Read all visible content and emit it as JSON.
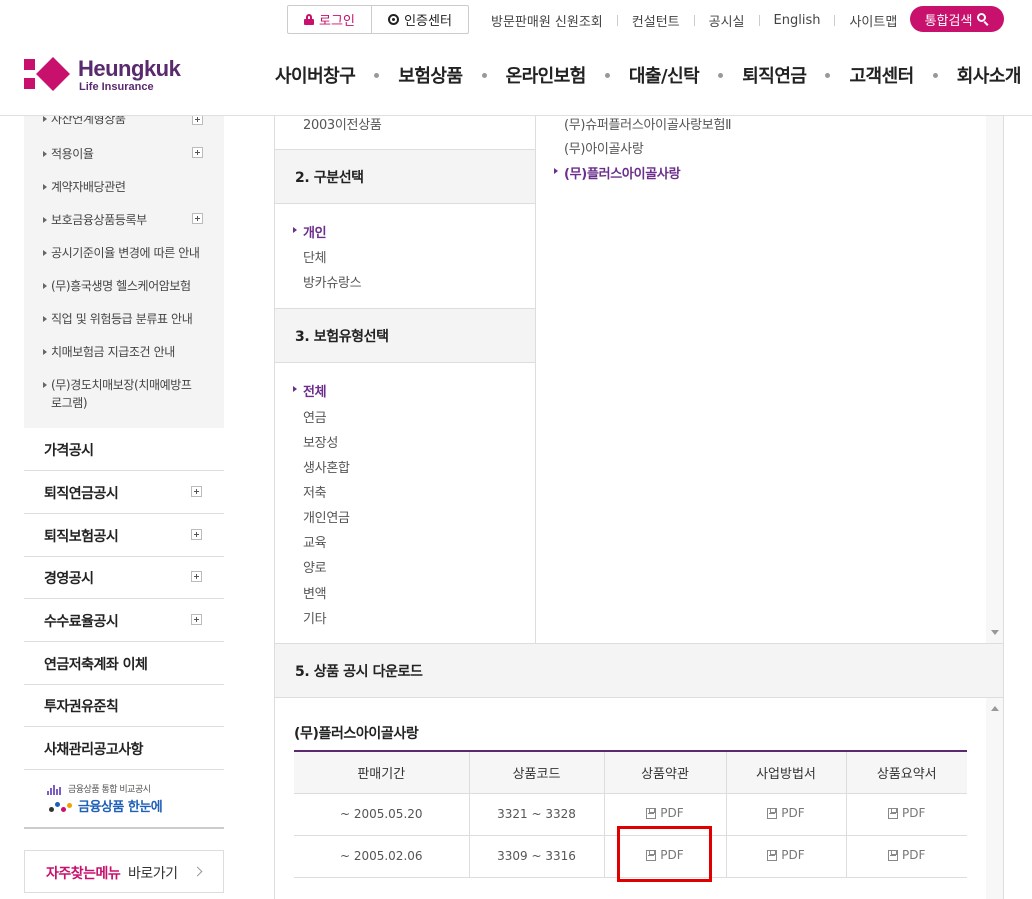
{
  "header": {
    "login_label": "로그인",
    "cert_label": "인증센터",
    "util_links": [
      "방문판매원 신원조회",
      "컨설턴트",
      "공시실",
      "English",
      "사이트맵"
    ],
    "search_label": "통합검색",
    "logo_name": "Heungkuk",
    "logo_sub": "Life Insurance",
    "gnb": [
      "사이버창구",
      "보험상품",
      "온라인보험",
      "대출/신탁",
      "퇴직연금",
      "고객센터",
      "회사소개"
    ]
  },
  "sidebar": {
    "sub_items": [
      "자산연계형상품",
      "적용이율",
      "계약자배당관련",
      "보호금융상품등록부",
      "공시기준이율 변경에 따른 안내",
      "(무)흥국생명 헬스케어암보험",
      "직업 및 위험등급 분류표 안내",
      "치매보험금 지급조건 안내",
      "(무)경도치매보장(치매예방프로그램)"
    ],
    "main_items": [
      "가격공시",
      "퇴직연금공시",
      "퇴직보험공시",
      "경영공시",
      "수수료율공시",
      "연금저축계좌 이체",
      "투자권유준칙",
      "사채관리공고사항"
    ],
    "banner_line1": "금융상품 통합 비교공시",
    "banner_line2": "금융상품 한눈에",
    "quick_highlight": "자주찾는메뉴",
    "quick_rest": "바로가기"
  },
  "selector": {
    "prev_option": "2003이전상품",
    "section2_title": "2. 구분선택",
    "section2_options": [
      "개인",
      "단체",
      "방카슈랑스"
    ],
    "section3_title": "3. 보험유형선택",
    "section3_options": [
      "전체",
      "연금",
      "보장성",
      "생사혼합",
      "저축",
      "개인연금",
      "교육",
      "양로",
      "변액",
      "기타"
    ],
    "products": [
      "(무)슈퍼플러스아이골사랑보험Ⅱ",
      "(무)아이골사랑",
      "(무)플러스아이골사랑"
    ]
  },
  "download": {
    "section_title": "5. 상품 공시 다운로드",
    "product_title": "(무)플러스아이골사랑",
    "columns": [
      "판매기간",
      "상품코드",
      "상품약관",
      "사업방법서",
      "상품요약서"
    ],
    "rows": [
      {
        "period": "~ 2005.05.20",
        "code": "3321 ~ 3328",
        "terms": "PDF",
        "method": "PDF",
        "summary": "PDF"
      },
      {
        "period": "~ 2005.02.06",
        "code": "3309 ~ 3316",
        "terms": "PDF",
        "method": "PDF",
        "summary": "PDF"
      }
    ]
  },
  "colors": {
    "brand": "#c8106d",
    "purple": "#5a2a6e",
    "selected": "#6b2e8c",
    "highlight": "#e00000"
  }
}
